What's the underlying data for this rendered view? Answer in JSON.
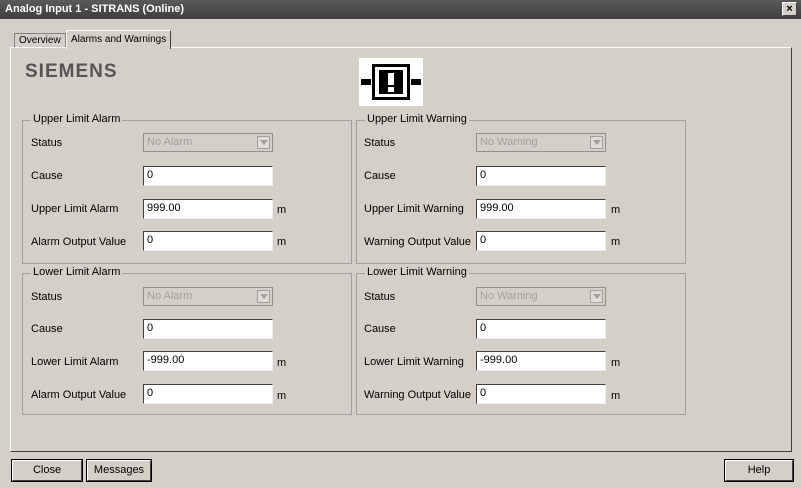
{
  "window": {
    "title": "Analog Input 1 - SITRANS  (Online)",
    "close_glyph": "×"
  },
  "tabs": [
    {
      "label": "Overview"
    },
    {
      "label": "Alarms and Warnings"
    }
  ],
  "brand": {
    "logo_text": "SIEMENS",
    "icon": "warning-exclamation-icon"
  },
  "upper_alarm": {
    "legend": "Upper Limit Alarm",
    "status_label": "Status",
    "status_value": "No Alarm",
    "cause_label": "Cause",
    "cause_value": "0",
    "limit_label": "Upper Limit Alarm",
    "limit_value": "999.00",
    "limit_unit": "m",
    "output_label": "Alarm Output Value",
    "output_value": "0",
    "output_unit": "m"
  },
  "upper_warning": {
    "legend": "Upper Limit Warning",
    "status_label": "Status",
    "status_value": "No Warning",
    "cause_label": "Cause",
    "cause_value": "0",
    "limit_label": "Upper Limit Warning",
    "limit_value": "999.00",
    "limit_unit": "m",
    "output_label": "Warning Output Value",
    "output_value": "0",
    "output_unit": "m"
  },
  "lower_alarm": {
    "legend": "Lower Limit Alarm",
    "status_label": "Status",
    "status_value": "No Alarm",
    "cause_label": "Cause",
    "cause_value": "0",
    "limit_label": "Lower Limit Alarm",
    "limit_value": "-999.00",
    "limit_unit": "m",
    "output_label": "Alarm Output Value",
    "output_value": "0",
    "output_unit": "m"
  },
  "lower_warning": {
    "legend": "Lower Limit Warning",
    "status_label": "Status",
    "status_value": "No Warning",
    "cause_label": "Cause",
    "cause_value": "0",
    "limit_label": "Lower Limit Warning",
    "limit_value": "-999.00",
    "limit_unit": "m",
    "output_label": "Warning Output Value",
    "output_value": "0",
    "output_unit": "m"
  },
  "buttons": {
    "close": "Close",
    "messages": "Messages",
    "help": "Help"
  }
}
